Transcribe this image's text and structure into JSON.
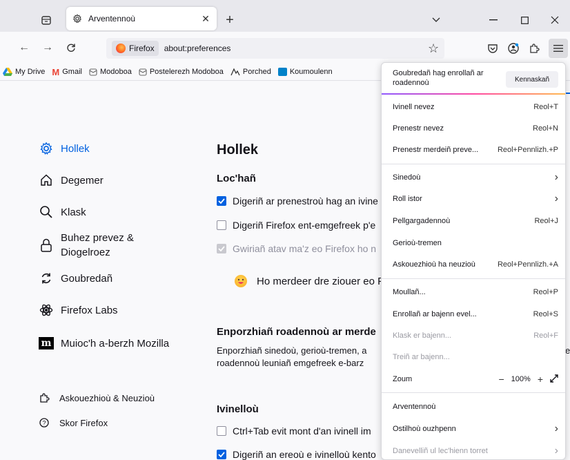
{
  "tab": {
    "title": "Arventennoù",
    "icon": "gear-icon"
  },
  "urlbar": {
    "identity": "Firefox",
    "url": "about:preferences"
  },
  "bookmarks": [
    {
      "label": "My Drive",
      "icon": "google-drive-icon"
    },
    {
      "label": "Gmail",
      "icon": "gmail-icon"
    },
    {
      "label": "Modoboa",
      "icon": "modoboa-icon"
    },
    {
      "label": "Postelerezh Modoboa",
      "icon": "modoboa-icon"
    },
    {
      "label": "Porched",
      "icon": "porched-icon"
    },
    {
      "label": "Koumoulenn",
      "icon": "koumoulenn-icon"
    }
  ],
  "sidebar": {
    "items": [
      {
        "label": "Hollek",
        "icon": "gear-icon"
      },
      {
        "label": "Degemer",
        "icon": "home-icon"
      },
      {
        "label": "Klask",
        "icon": "search-icon"
      },
      {
        "label": "Buhez prevez &",
        "label2": "Diogelroez",
        "icon": "lock-icon"
      },
      {
        "label": "Goubredañ",
        "icon": "sync-icon"
      },
      {
        "label": "Firefox Labs",
        "icon": "labs-icon"
      },
      {
        "label": "Muioc'h a-berzh Mozilla",
        "icon": "mozilla-icon"
      }
    ],
    "footer": [
      {
        "label": "Askouezhioù & Neuzioù",
        "icon": "puzzle-icon"
      },
      {
        "label": "Skor Firefox",
        "icon": "help-icon"
      }
    ]
  },
  "main": {
    "title": "Hollek",
    "startup_heading": "Loc'hañ",
    "cb1": "Digeriñ ar prenestroù hag an ivine",
    "cb2": "Digeriñ Firefox ent-emgefreek p'e",
    "cb3": "Gwiriañ atav ma'z eo Firefox ho n",
    "default_msg": "Ho merdeer dre ziouer eo F",
    "import_heading": "Enporzhiañ roadennoù ar merde",
    "import_line1": "Enporzhiañ sinedoù, gerioù-tremen, a",
    "import_line2": "roadennoù leuniañ emgefreek e-barz",
    "right_edge_text": "e",
    "tabs_heading": "Ivinelloù",
    "cb4": "Ctrl+Tab evit mont d'an ivinell im",
    "cb5": "Digeriñ an ereoù e ivinelloù kento"
  },
  "menu": {
    "sync_text": "Goubredañ hag enrollañ ar roadennoù",
    "sync_button": "Kennaskañ",
    "items": [
      {
        "label": "Ivinell nevez",
        "shortcut": "Reol+T"
      },
      {
        "label": "Prenestr nevez",
        "shortcut": "Reol+N"
      },
      {
        "label": "Prenestr merdeiñ preve...",
        "shortcut": "Reol+Pennlizh.+P"
      },
      {
        "label": "Sinedoù",
        "shortcut": "›"
      },
      {
        "label": "Roll istor",
        "shortcut": "›"
      },
      {
        "label": "Pellgargadennoù",
        "shortcut": "Reol+J"
      },
      {
        "label": "Gerioù-tremen",
        "shortcut": ""
      },
      {
        "label": "Askouezhioù ha neuzioù",
        "shortcut": "Reol+Pennlizh.+A"
      },
      {
        "label": "Moullañ...",
        "shortcut": "Reol+P"
      },
      {
        "label": "Enrollañ ar bajenn evel...",
        "shortcut": "Reol+S"
      },
      {
        "label": "Klask er bajenn...",
        "shortcut": "Reol+F"
      },
      {
        "label": "Treiñ ar bajenn...",
        "shortcut": ""
      },
      {
        "label": "Zoum",
        "zoom": "100%"
      },
      {
        "label": "Arventennoù",
        "shortcut": ""
      },
      {
        "label": "Ostilhoù ouzhpenn",
        "shortcut": "›"
      },
      {
        "label": "Danevelliñ ul lec'hienn torret",
        "shortcut": "›"
      }
    ]
  },
  "colors": {
    "accent": "#0061e0",
    "menu_bg": "#ffffff",
    "chrome_bg": "#e8e8ed"
  }
}
